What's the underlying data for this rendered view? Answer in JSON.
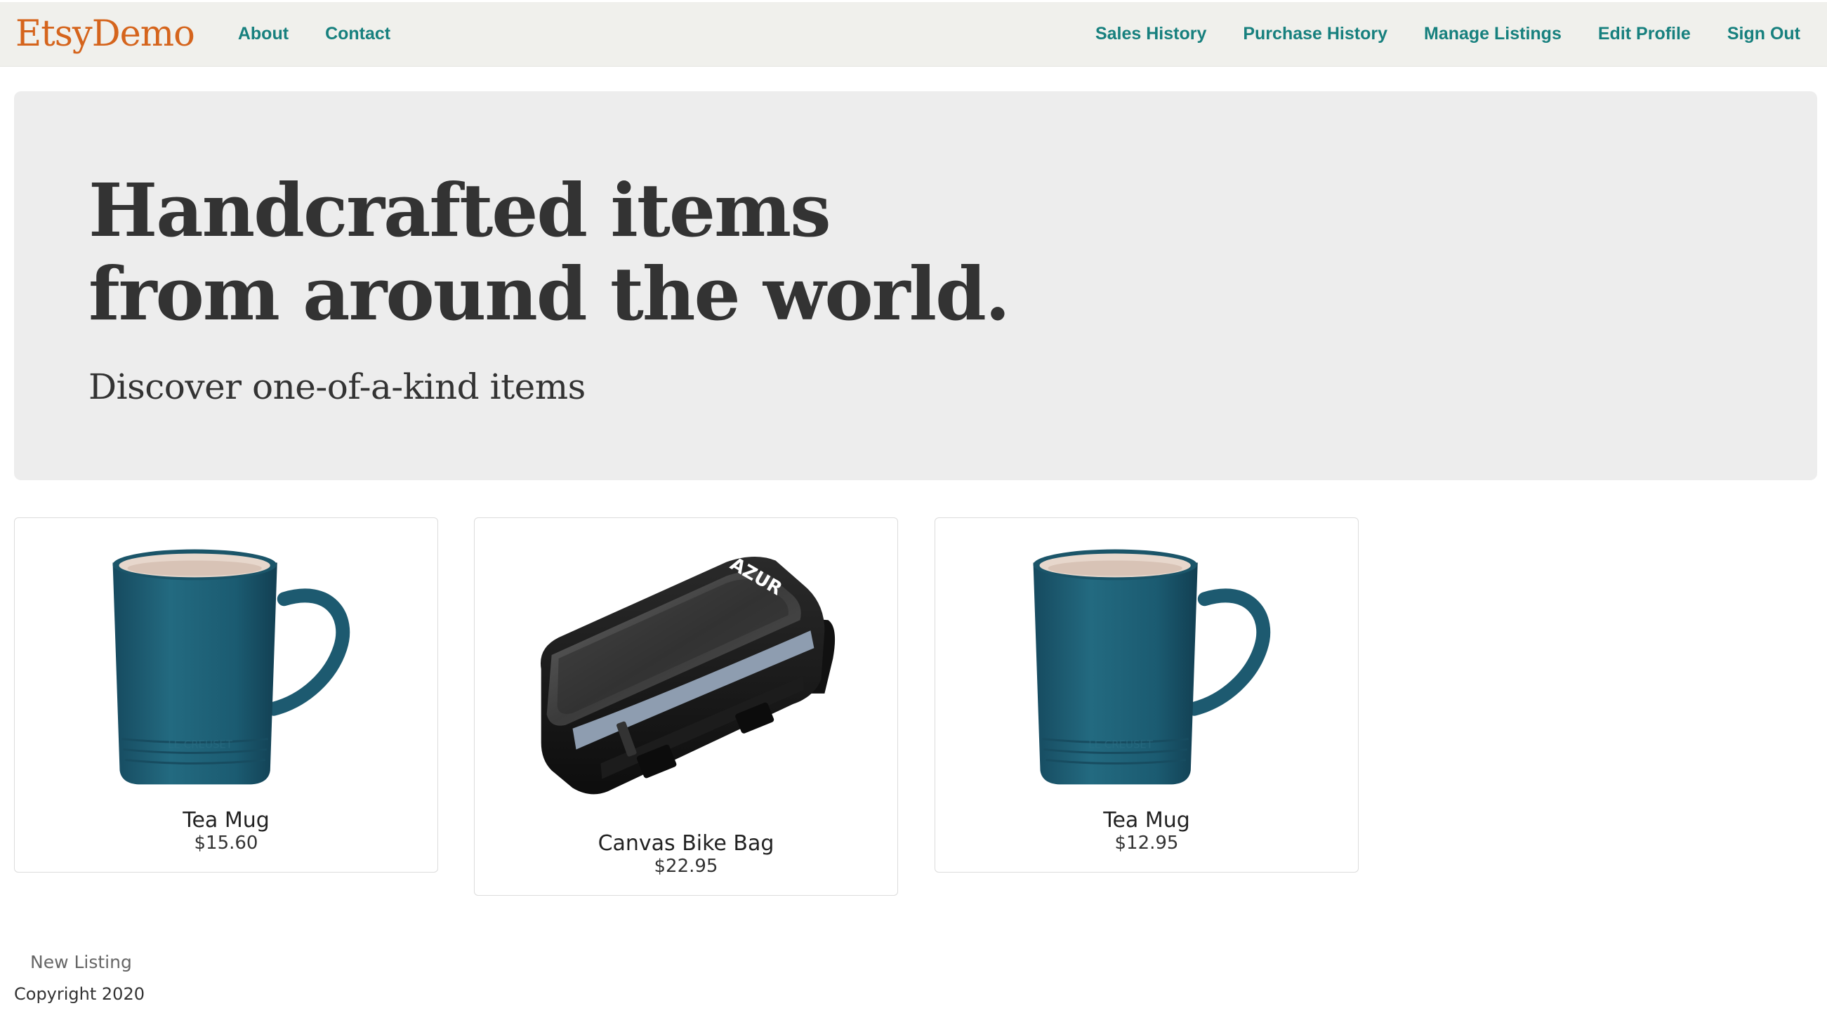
{
  "navbar": {
    "brand": "EtsyDemo",
    "left_links": [
      "About",
      "Contact"
    ],
    "right_links": [
      "Sales History",
      "Purchase History",
      "Manage Listings",
      "Edit Profile",
      "Sign Out"
    ],
    "link_color": "#17807e",
    "brand_color": "#d5641c"
  },
  "hero": {
    "title": "Handcrafted items from around the world.",
    "subtitle": "Discover one-of-a-kind items"
  },
  "listings": [
    {
      "title": "Tea Mug",
      "price": "$15.60",
      "image": "tea-mug"
    },
    {
      "title": "Canvas Bike Bag",
      "price": "$22.95",
      "image": "bike-bag",
      "image_text": "AZUR"
    },
    {
      "title": "Tea Mug",
      "price": "$12.95",
      "image": "tea-mug"
    }
  ],
  "footer": {
    "new_listing": "New Listing",
    "copyright": "Copyright 2020"
  }
}
